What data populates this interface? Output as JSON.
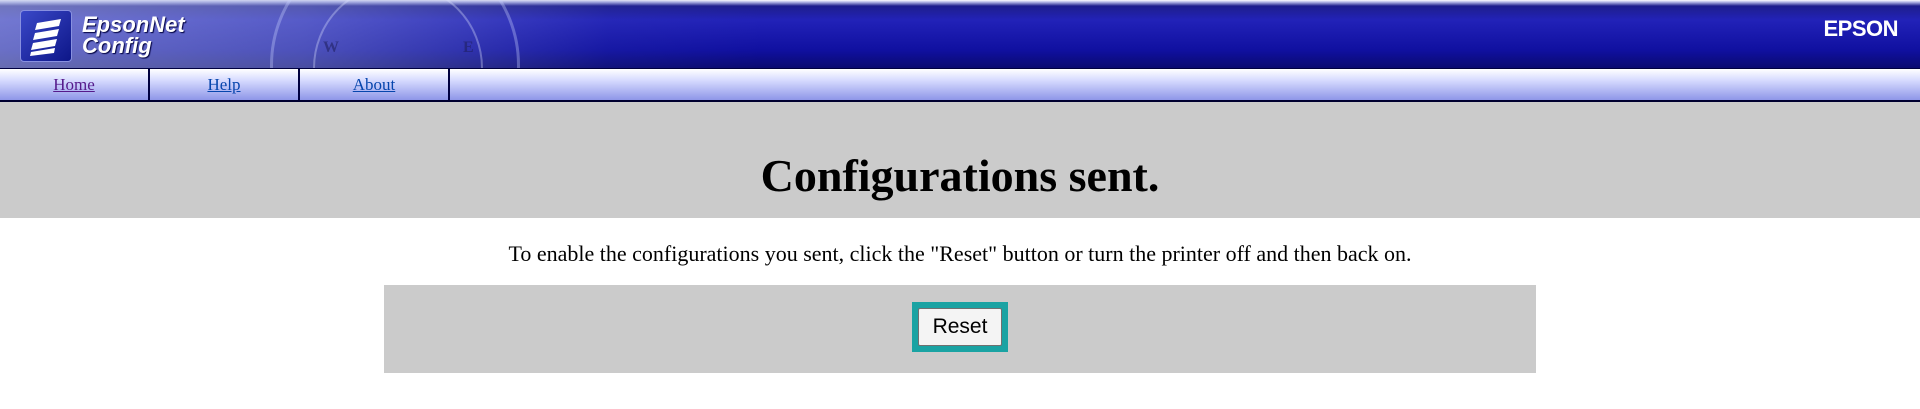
{
  "header": {
    "logo_line1": "EpsonNet",
    "logo_line2": "Config",
    "brand": "EPSON",
    "logo_icon": "epsonnet-config-logo-icon",
    "compass_letters": [
      "W",
      "E"
    ]
  },
  "nav": {
    "items": [
      {
        "label": "Home",
        "visited": true
      },
      {
        "label": "Help",
        "visited": false
      },
      {
        "label": "About",
        "visited": false
      }
    ]
  },
  "main": {
    "title": "Configurations sent.",
    "message": "To enable the configurations you sent, click the \"Reset\" button or turn the printer off and then back on.",
    "reset_label": "Reset"
  },
  "colors": {
    "header_blue": "#1e1e9c",
    "band_gray": "#cbcbcb",
    "focus_teal": "#1aa3a3",
    "visited_link": "#551a8b",
    "link": "#0645ad"
  }
}
